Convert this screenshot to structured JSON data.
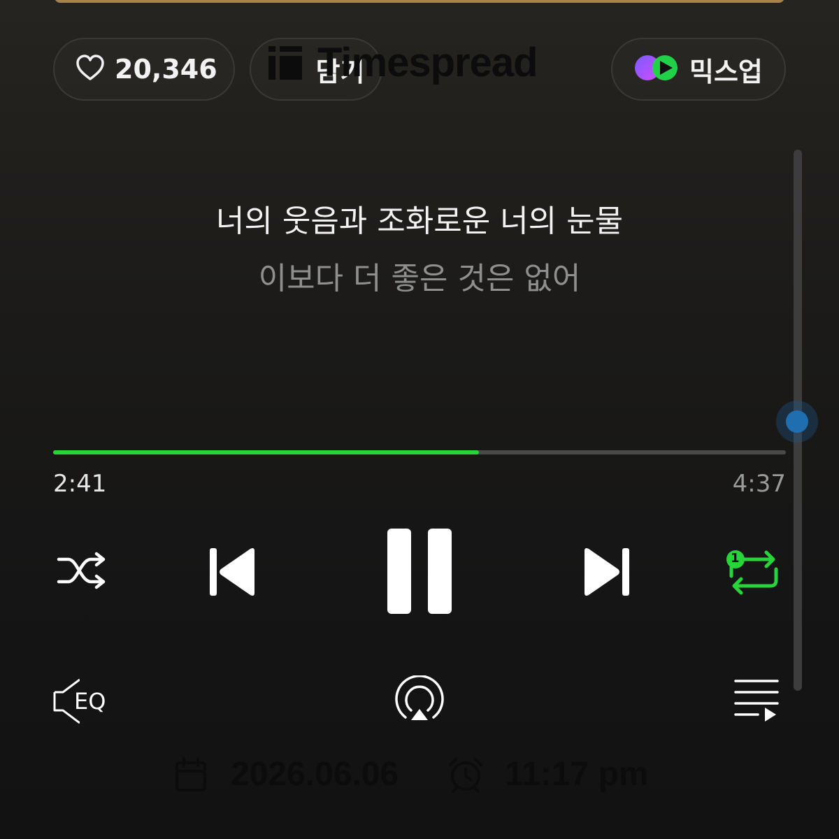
{
  "header": {
    "like_count": "20,346",
    "add_label": "담기",
    "mixup_label": "믹스업"
  },
  "watermark": {
    "brand": "Timespread"
  },
  "lyrics": {
    "current": "너의 웃음과 조화로운 너의 눈물",
    "next": "이보다 더 좋은 것은 없어"
  },
  "player": {
    "elapsed": "2:41",
    "total": "4:37",
    "progress_fraction": 0.581,
    "accent_color": "#27d43a",
    "repeat_badge": "1",
    "eq_label": "EQ"
  },
  "footer": {
    "date": "2026.06.06",
    "time": "11:17 pm"
  },
  "icons": [
    "heart-icon",
    "plus-icon",
    "mixup-icon",
    "shuffle-icon",
    "previous-icon",
    "pause-icon",
    "next-icon",
    "repeat-one-icon",
    "eq-icon",
    "airplay-icon",
    "playlist-icon",
    "calendar-icon",
    "alarm-clock-icon"
  ]
}
